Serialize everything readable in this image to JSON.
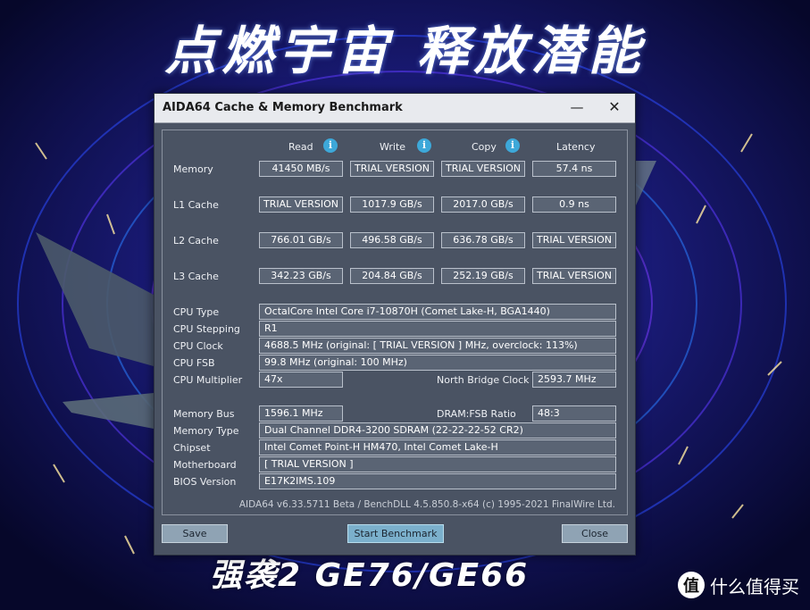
{
  "background": {
    "headline": "点燃宇宙 释放潜能",
    "tagline": "强袭2 GE76/GE66",
    "watermark_logo": "值",
    "watermark_text": "什么值得买"
  },
  "window": {
    "title": "AIDA64 Cache & Memory Benchmark",
    "minimize_icon": "—",
    "close_icon": "✕"
  },
  "columns": {
    "read": "Read",
    "write": "Write",
    "copy": "Copy",
    "latency": "Latency",
    "info_icon": "i"
  },
  "rows": {
    "memory": {
      "label": "Memory",
      "read": "41450 MB/s",
      "write": "TRIAL VERSION",
      "copy": "TRIAL VERSION",
      "latency": "57.4 ns"
    },
    "l1": {
      "label": "L1 Cache",
      "read": "TRIAL VERSION",
      "write": "1017.9 GB/s",
      "copy": "2017.0 GB/s",
      "latency": "0.9 ns"
    },
    "l2": {
      "label": "L2 Cache",
      "read": "766.01 GB/s",
      "write": "496.58 GB/s",
      "copy": "636.78 GB/s",
      "latency": "TRIAL VERSION"
    },
    "l3": {
      "label": "L3 Cache",
      "read": "342.23 GB/s",
      "write": "204.84 GB/s",
      "copy": "252.19 GB/s",
      "latency": "TRIAL VERSION"
    }
  },
  "cpu": {
    "type_label": "CPU Type",
    "type": "OctalCore Intel Core i7-10870H  (Comet Lake-H, BGA1440)",
    "stepping_label": "CPU Stepping",
    "stepping": "R1",
    "clock_label": "CPU Clock",
    "clock": "4688.5 MHz  (original: [ TRIAL VERSION ] MHz, overclock: 113%)",
    "fsb_label": "CPU FSB",
    "fsb": "99.8 MHz  (original: 100 MHz)",
    "multiplier_label": "CPU Multiplier",
    "multiplier": "47x",
    "nb_clock_label": "North Bridge Clock",
    "nb_clock": "2593.7 MHz"
  },
  "memory_info": {
    "bus_label": "Memory Bus",
    "bus": "1596.1 MHz",
    "ratio_label": "DRAM:FSB Ratio",
    "ratio": "48:3",
    "type_label": "Memory Type",
    "type": "Dual Channel DDR4-3200 SDRAM  (22-22-22-52 CR2)",
    "chipset_label": "Chipset",
    "chipset": "Intel Comet Point-H HM470, Intel Comet Lake-H",
    "motherboard_label": "Motherboard",
    "motherboard": "[ TRIAL VERSION ]",
    "bios_label": "BIOS Version",
    "bios": "E17K2IMS.109"
  },
  "footer": "AIDA64 v6.33.5711 Beta / BenchDLL 4.5.850.8-x64  (c) 1995-2021 FinalWire Ltd.",
  "buttons": {
    "save": "Save",
    "start": "Start Benchmark",
    "close": "Close"
  }
}
